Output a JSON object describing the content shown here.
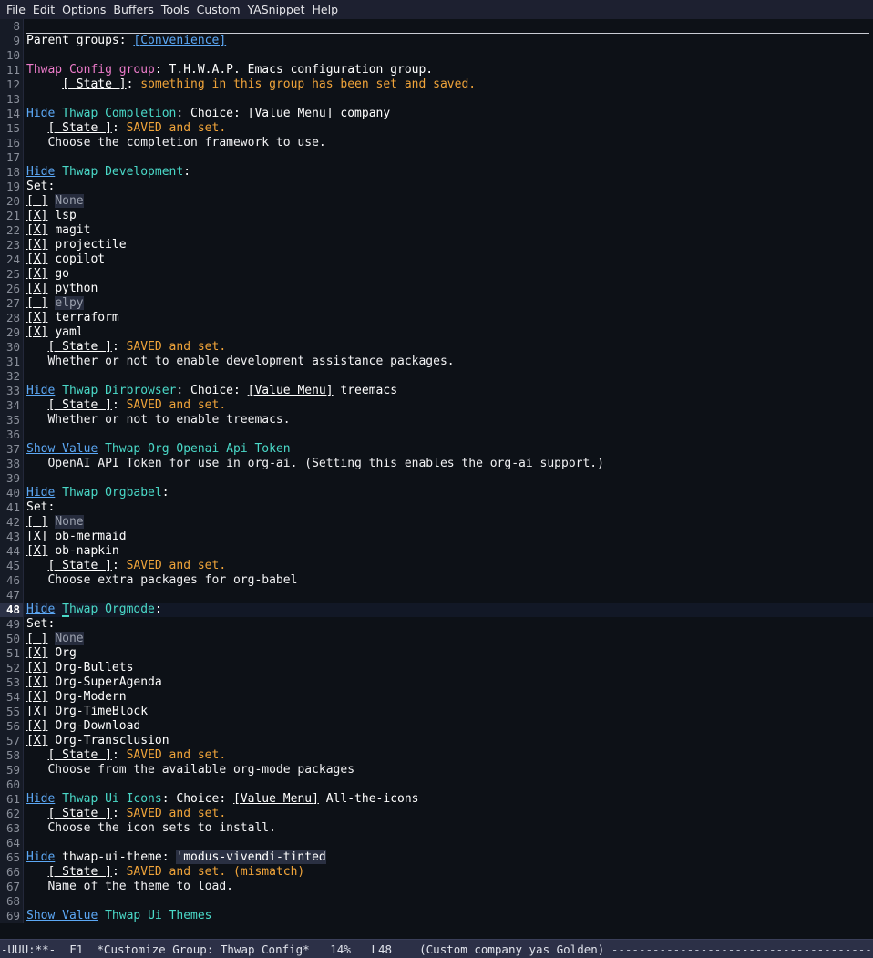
{
  "menubar": {
    "items": [
      "File",
      "Edit",
      "Options",
      "Buffers",
      "Tools",
      "Custom",
      "YASnippet",
      "Help"
    ]
  },
  "colors": {
    "background": "#0d1117",
    "gutter_background": "#161b26",
    "menubar_background": "#1d2030",
    "modeline_background": "#2c3047",
    "link": "#5ca8f5",
    "group_name": "#4ad9c8",
    "group_title": "#ee7ccb",
    "state_value": "#f0a43a",
    "inactive_text": "#9aa0ad",
    "field_background": "#2a3042",
    "current_line_gutter": "#2b3146"
  },
  "buffer": {
    "name": "*Customize Group: Thwap Config*",
    "first_line": 8,
    "current_line": 48,
    "lines": [
      {
        "n": 8,
        "type": "rule"
      },
      {
        "n": 9,
        "type": "rich",
        "spans": [
          {
            "t": "Parent groups: ",
            "f": "f-plain"
          },
          {
            "t": "[Convenience]",
            "f": "f-link",
            "name": "parent-group-link-convenience",
            "i": true
          }
        ]
      },
      {
        "n": 10,
        "type": "blank"
      },
      {
        "n": 11,
        "type": "rich",
        "spans": [
          {
            "t": "Thwap Config group",
            "f": "f-grouppink",
            "name": "group-title"
          },
          {
            "t": ": T.H.W.A.P. Emacs configuration group.",
            "f": "f-plain"
          }
        ]
      },
      {
        "n": 12,
        "type": "rich",
        "spans": [
          {
            "t": "     ",
            "f": "f-plain"
          },
          {
            "t": "[ State ]",
            "f": "f-state",
            "name": "state-button",
            "i": true
          },
          {
            "t": ": ",
            "f": "f-plain"
          },
          {
            "t": "something in this group has been set and saved.",
            "f": "f-saved"
          }
        ]
      },
      {
        "n": 13,
        "type": "blank"
      },
      {
        "n": 14,
        "type": "rich",
        "spans": [
          {
            "t": "Hide",
            "f": "f-link",
            "name": "hide-toggle-completion",
            "i": true
          },
          {
            "t": " ",
            "f": "f-plain"
          },
          {
            "t": "Thwap Completion",
            "f": "f-group",
            "name": "option-name-thwap-completion"
          },
          {
            "t": ": Choice: ",
            "f": "f-plain"
          },
          {
            "t": "[Value Menu]",
            "f": "f-box",
            "name": "value-menu-button-completion",
            "i": true
          },
          {
            "t": " company",
            "f": "f-plain"
          }
        ]
      },
      {
        "n": 15,
        "type": "rich",
        "spans": [
          {
            "t": "   ",
            "f": "f-plain"
          },
          {
            "t": "[ State ]",
            "f": "f-state",
            "name": "state-button",
            "i": true
          },
          {
            "t": ": ",
            "f": "f-plain"
          },
          {
            "t": "SAVED and set.",
            "f": "f-saved"
          }
        ]
      },
      {
        "n": 16,
        "type": "rich",
        "spans": [
          {
            "t": "   Choose the completion framework to use.",
            "f": "f-doc"
          }
        ]
      },
      {
        "n": 17,
        "type": "blank"
      },
      {
        "n": 18,
        "type": "rich",
        "spans": [
          {
            "t": "Hide",
            "f": "f-link",
            "name": "hide-toggle-development",
            "i": true
          },
          {
            "t": " ",
            "f": "f-plain"
          },
          {
            "t": "Thwap Development",
            "f": "f-group",
            "name": "option-name-thwap-development"
          },
          {
            "t": ":",
            "f": "f-plain"
          }
        ]
      },
      {
        "n": 19,
        "type": "rich",
        "spans": [
          {
            "t": "Set:",
            "f": "f-plain"
          }
        ]
      },
      {
        "n": 20,
        "type": "checkbox",
        "checked": false,
        "label": "None"
      },
      {
        "n": 21,
        "type": "checkbox",
        "checked": true,
        "label": "lsp"
      },
      {
        "n": 22,
        "type": "checkbox",
        "checked": true,
        "label": "magit"
      },
      {
        "n": 23,
        "type": "checkbox",
        "checked": true,
        "label": "projectile"
      },
      {
        "n": 24,
        "type": "checkbox",
        "checked": true,
        "label": "copilot"
      },
      {
        "n": 25,
        "type": "checkbox",
        "checked": true,
        "label": "go"
      },
      {
        "n": 26,
        "type": "checkbox",
        "checked": true,
        "label": "python"
      },
      {
        "n": 27,
        "type": "checkbox",
        "checked": false,
        "label": "elpy"
      },
      {
        "n": 28,
        "type": "checkbox",
        "checked": true,
        "label": "terraform"
      },
      {
        "n": 29,
        "type": "checkbox",
        "checked": true,
        "label": "yaml"
      },
      {
        "n": 30,
        "type": "rich",
        "spans": [
          {
            "t": "   ",
            "f": "f-plain"
          },
          {
            "t": "[ State ]",
            "f": "f-state",
            "name": "state-button",
            "i": true
          },
          {
            "t": ": ",
            "f": "f-plain"
          },
          {
            "t": "SAVED and set.",
            "f": "f-saved"
          }
        ]
      },
      {
        "n": 31,
        "type": "rich",
        "spans": [
          {
            "t": "   Whether or not to enable development assistance packages.",
            "f": "f-doc"
          }
        ]
      },
      {
        "n": 32,
        "type": "blank"
      },
      {
        "n": 33,
        "type": "rich",
        "spans": [
          {
            "t": "Hide",
            "f": "f-link",
            "name": "hide-toggle-dirbrowser",
            "i": true
          },
          {
            "t": " ",
            "f": "f-plain"
          },
          {
            "t": "Thwap Dirbrowser",
            "f": "f-group",
            "name": "option-name-thwap-dirbrowser"
          },
          {
            "t": ": Choice: ",
            "f": "f-plain"
          },
          {
            "t": "[Value Menu]",
            "f": "f-box",
            "name": "value-menu-button-dirbrowser",
            "i": true
          },
          {
            "t": " treemacs",
            "f": "f-plain"
          }
        ]
      },
      {
        "n": 34,
        "type": "rich",
        "spans": [
          {
            "t": "   ",
            "f": "f-plain"
          },
          {
            "t": "[ State ]",
            "f": "f-state",
            "name": "state-button",
            "i": true
          },
          {
            "t": ": ",
            "f": "f-plain"
          },
          {
            "t": "SAVED and set.",
            "f": "f-saved"
          }
        ]
      },
      {
        "n": 35,
        "type": "rich",
        "spans": [
          {
            "t": "   Whether or not to enable treemacs.",
            "f": "f-doc"
          }
        ]
      },
      {
        "n": 36,
        "type": "blank"
      },
      {
        "n": 37,
        "type": "rich",
        "spans": [
          {
            "t": "Show Value",
            "f": "f-link",
            "name": "show-value-toggle-org-openai-api-token",
            "i": true
          },
          {
            "t": " ",
            "f": "f-plain"
          },
          {
            "t": "Thwap Org Openai Api Token",
            "f": "f-group",
            "name": "option-name-thwap-org-openai-api-token"
          }
        ]
      },
      {
        "n": 38,
        "type": "rich",
        "spans": [
          {
            "t": "   OpenAI API Token for use in org-ai. (Setting this enables the org-ai support.)",
            "f": "f-doc"
          }
        ]
      },
      {
        "n": 39,
        "type": "blank"
      },
      {
        "n": 40,
        "type": "rich",
        "spans": [
          {
            "t": "Hide",
            "f": "f-link",
            "name": "hide-toggle-orgbabel",
            "i": true
          },
          {
            "t": " ",
            "f": "f-plain"
          },
          {
            "t": "Thwap Orgbabel",
            "f": "f-group",
            "name": "option-name-thwap-orgbabel"
          },
          {
            "t": ":",
            "f": "f-plain"
          }
        ]
      },
      {
        "n": 41,
        "type": "rich",
        "spans": [
          {
            "t": "Set:",
            "f": "f-plain"
          }
        ]
      },
      {
        "n": 42,
        "type": "checkbox",
        "checked": false,
        "label": "None"
      },
      {
        "n": 43,
        "type": "checkbox",
        "checked": true,
        "label": "ob-mermaid"
      },
      {
        "n": 44,
        "type": "checkbox",
        "checked": true,
        "label": "ob-napkin"
      },
      {
        "n": 45,
        "type": "rich",
        "spans": [
          {
            "t": "   ",
            "f": "f-plain"
          },
          {
            "t": "[ State ]",
            "f": "f-state",
            "name": "state-button",
            "i": true
          },
          {
            "t": ": ",
            "f": "f-plain"
          },
          {
            "t": "SAVED and set.",
            "f": "f-saved"
          }
        ]
      },
      {
        "n": 46,
        "type": "rich",
        "spans": [
          {
            "t": "   Choose extra packages for org-babel",
            "f": "f-doc"
          }
        ]
      },
      {
        "n": 47,
        "type": "blank"
      },
      {
        "n": 48,
        "type": "rich",
        "current": true,
        "spans": [
          {
            "t": "Hide",
            "f": "f-link",
            "name": "hide-toggle-orgmode",
            "i": true
          },
          {
            "t": " ",
            "f": "f-plain"
          },
          {
            "t": "T",
            "f": "f-group",
            "cursor": true,
            "name": "text-cursor"
          },
          {
            "t": "hwap Orgmode",
            "f": "f-group",
            "name": "option-name-thwap-orgmode"
          },
          {
            "t": ":",
            "f": "f-plain"
          }
        ]
      },
      {
        "n": 49,
        "type": "rich",
        "spans": [
          {
            "t": "Set:",
            "f": "f-plain"
          }
        ]
      },
      {
        "n": 50,
        "type": "checkbox",
        "checked": false,
        "label": "None"
      },
      {
        "n": 51,
        "type": "checkbox",
        "checked": true,
        "label": "Org"
      },
      {
        "n": 52,
        "type": "checkbox",
        "checked": true,
        "label": "Org-Bullets"
      },
      {
        "n": 53,
        "type": "checkbox",
        "checked": true,
        "label": "Org-SuperAgenda"
      },
      {
        "n": 54,
        "type": "checkbox",
        "checked": true,
        "label": "Org-Modern"
      },
      {
        "n": 55,
        "type": "checkbox",
        "checked": true,
        "label": "Org-TimeBlock"
      },
      {
        "n": 56,
        "type": "checkbox",
        "checked": true,
        "label": "Org-Download"
      },
      {
        "n": 57,
        "type": "checkbox",
        "checked": true,
        "label": "Org-Transclusion"
      },
      {
        "n": 58,
        "type": "rich",
        "spans": [
          {
            "t": "   ",
            "f": "f-plain"
          },
          {
            "t": "[ State ]",
            "f": "f-state",
            "name": "state-button",
            "i": true
          },
          {
            "t": ": ",
            "f": "f-plain"
          },
          {
            "t": "SAVED and set.",
            "f": "f-saved"
          }
        ]
      },
      {
        "n": 59,
        "type": "rich",
        "spans": [
          {
            "t": "   Choose from the available org-mode packages",
            "f": "f-doc"
          }
        ]
      },
      {
        "n": 60,
        "type": "blank"
      },
      {
        "n": 61,
        "type": "rich",
        "spans": [
          {
            "t": "Hide",
            "f": "f-link",
            "name": "hide-toggle-ui-icons",
            "i": true
          },
          {
            "t": " ",
            "f": "f-plain"
          },
          {
            "t": "Thwap Ui Icons",
            "f": "f-group",
            "name": "option-name-thwap-ui-icons"
          },
          {
            "t": ": Choice: ",
            "f": "f-plain"
          },
          {
            "t": "[Value Menu]",
            "f": "f-box",
            "name": "value-menu-button-ui-icons",
            "i": true
          },
          {
            "t": " All-the-icons",
            "f": "f-plain"
          }
        ]
      },
      {
        "n": 62,
        "type": "rich",
        "spans": [
          {
            "t": "   ",
            "f": "f-plain"
          },
          {
            "t": "[ State ]",
            "f": "f-state",
            "name": "state-button",
            "i": true
          },
          {
            "t": ": ",
            "f": "f-plain"
          },
          {
            "t": "SAVED and set.",
            "f": "f-saved"
          }
        ]
      },
      {
        "n": 63,
        "type": "rich",
        "spans": [
          {
            "t": "   Choose the icon sets to install.",
            "f": "f-doc"
          }
        ]
      },
      {
        "n": 64,
        "type": "blank"
      },
      {
        "n": 65,
        "type": "rich",
        "spans": [
          {
            "t": "Hide",
            "f": "f-link",
            "name": "hide-toggle-thwap-ui-theme",
            "i": true
          },
          {
            "t": " thwap-ui-theme: ",
            "f": "f-plain"
          },
          {
            "t": "'modus-vivendi-tinted",
            "f": "f-field",
            "name": "theme-value-field",
            "i": true
          }
        ]
      },
      {
        "n": 66,
        "type": "rich",
        "spans": [
          {
            "t": "   ",
            "f": "f-plain"
          },
          {
            "t": "[ State ]",
            "f": "f-state",
            "name": "state-button",
            "i": true
          },
          {
            "t": ": ",
            "f": "f-plain"
          },
          {
            "t": "SAVED and set. (mismatch)",
            "f": "f-saved"
          }
        ]
      },
      {
        "n": 67,
        "type": "rich",
        "spans": [
          {
            "t": "   Name of the theme to load.",
            "f": "f-doc"
          }
        ]
      },
      {
        "n": 68,
        "type": "blank"
      },
      {
        "n": 69,
        "type": "rich",
        "spans": [
          {
            "t": "Show Value",
            "f": "f-link",
            "name": "show-value-toggle-ui-themes",
            "i": true
          },
          {
            "t": " ",
            "f": "f-plain"
          },
          {
            "t": "Thwap Ui Themes",
            "f": "f-group",
            "name": "option-name-thwap-ui-themes"
          }
        ]
      }
    ]
  },
  "modeline": {
    "mode_status": "-UUU:**-",
    "frame_id": "F1",
    "buffer_name": "*Customize Group: Thwap Config*",
    "percent": "14%",
    "line_indicator": "L48",
    "minor_modes": "(Custom company yas Golden)",
    "filler": "-------------------------------------------------------------"
  },
  "checkbox": {
    "checked_glyph": "[X]",
    "unchecked_glyph": "[ ]"
  }
}
